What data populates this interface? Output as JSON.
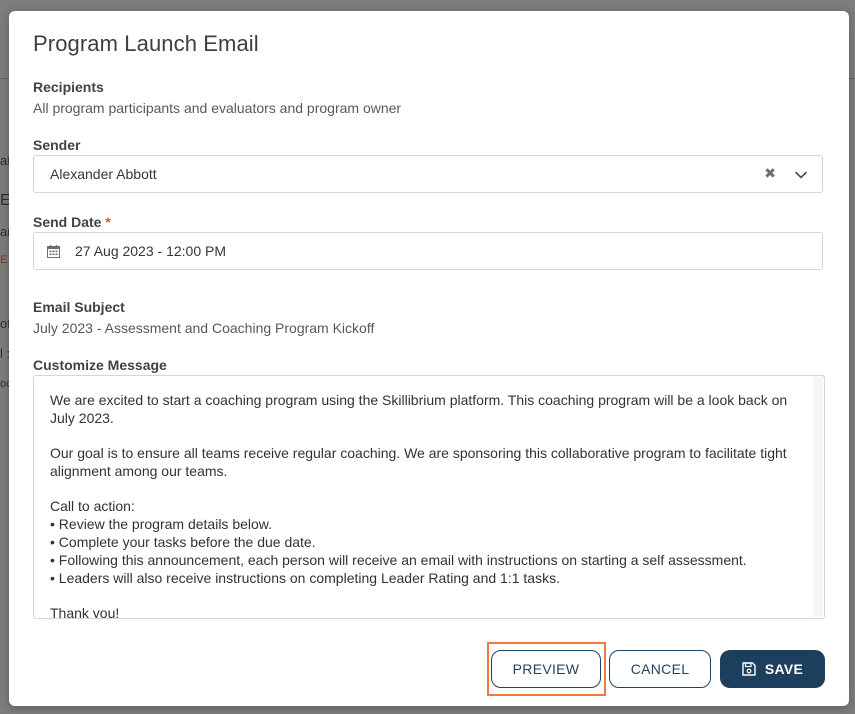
{
  "modal": {
    "title": "Program Launch Email"
  },
  "recipients": {
    "label": "Recipients",
    "value": "All program participants and evaluators and program owner"
  },
  "sender": {
    "label": "Sender",
    "value": "Alexander Abbott",
    "clear_glyph": "✖"
  },
  "send_date": {
    "label": "Send Date",
    "required_mark": "*",
    "value": "27 Aug 2023 - 12:00 PM"
  },
  "email_subject": {
    "label": "Email Subject",
    "value": "July 2023 - Assessment and Coaching Program Kickoff"
  },
  "message": {
    "label": "Customize Message",
    "paragraph1": "We are excited to start a coaching program using the Skillibrium platform. This coaching program will be a look back on July 2023.",
    "paragraph2": "Our goal is to ensure all teams receive regular coaching. We are sponsoring this collaborative program to facilitate tight alignment among our teams.",
    "cta_heading": "Call to action:",
    "cta_items": [
      "• Review the program details below.",
      "• Complete your tasks before the due date.",
      "• Following this announcement, each person will receive an email with instructions on starting a self assessment.",
      "• Leaders will also receive instructions on completing Leader Rating and 1:1 tasks."
    ],
    "closing": "Thank you!"
  },
  "buttons": {
    "preview": "PREVIEW",
    "cancel": "CANCEL",
    "save": "SAVE"
  },
  "background_fragments": [
    "ati",
    "E",
    "an",
    "E N",
    "ot",
    "l :",
    "oc"
  ],
  "colors": {
    "primary": "#1d3f5e",
    "required": "#e4572e",
    "highlight": "#ee7a3f",
    "backdrop": "#7d7d7d"
  }
}
